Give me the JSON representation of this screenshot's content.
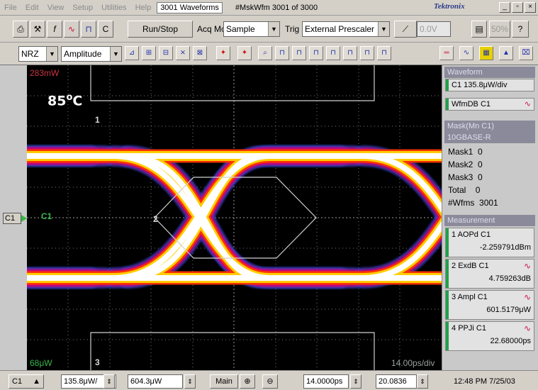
{
  "menu": {
    "items": [
      "File",
      "Edit",
      "View",
      "Setup",
      "Utilities",
      "Help"
    ],
    "waveforms_title": "3001 Waveforms",
    "wfm_count": "#MskWfm  3001 of 3000",
    "brand": "Tektronix",
    "window_buttons": [
      "_",
      "▫",
      "×"
    ]
  },
  "toolbar1": {
    "run_stop": "Run/Stop",
    "acq_mode_label": "Acq Mode",
    "acq_mode_value": "Sample",
    "trig_label": "Trig",
    "trig_value": "External Prescaler",
    "trig_level": "0.0V",
    "zoom_pct": "50%",
    "c_label": "C"
  },
  "toolbar2": {
    "pattern_value": "NRZ",
    "measure_value": "Amplitude"
  },
  "display": {
    "temperature": "85",
    "temperature_unit": "C",
    "top_readout": "283mW",
    "bottom_readout": "68μW",
    "timebase_readout": "14.00ps/div",
    "channel_label": "C1",
    "mask_labels": [
      "1",
      "2",
      "3"
    ]
  },
  "channel_marker": "C1",
  "right_panel": {
    "waveform_header": "Waveform",
    "waveform_item": "C1 135.8μW/div",
    "wfmdb_item": "WfmDB C1",
    "mask_header": [
      "Mask(Mn C1)",
      "10GBASE-R"
    ],
    "mask_rows": [
      {
        "label": "Mask1",
        "value": "0"
      },
      {
        "label": "Mask2",
        "value": "0"
      },
      {
        "label": "Mask3",
        "value": "0"
      },
      {
        "label": "Total",
        "value": "0"
      }
    ],
    "wfms_label": "#Wfms",
    "wfms_value": "3001",
    "measurement_header": "Measurement",
    "measurements": [
      {
        "index": "1",
        "name": "AOPd",
        "source": "C1",
        "value": "-2.259791dBm"
      },
      {
        "index": "2",
        "name": "ExdB",
        "source": "C1",
        "value": "4.759263dB"
      },
      {
        "index": "3",
        "name": "Ampl",
        "source": "C1",
        "value": "601.5179μW"
      },
      {
        "index": "4",
        "name": "PPJi",
        "source": "C1",
        "value": "22.68000ps"
      }
    ]
  },
  "bottom": {
    "channel": "C1",
    "vert_scale": "135.8μW/",
    "vert_offset": "604.3μW",
    "main_label": "Main",
    "horiz_scale": "14.0000ps",
    "horiz_pos": "20.0836",
    "timestamp": "12:48 PM 7/25/03"
  },
  "colors": {
    "eye_hot": "#ffffff",
    "eye_mid": "#ffcc00",
    "eye_warm": "#ff3300",
    "eye_cool": "#cc0077",
    "eye_edge": "#3344cc",
    "status_green": "#1fa24a"
  }
}
